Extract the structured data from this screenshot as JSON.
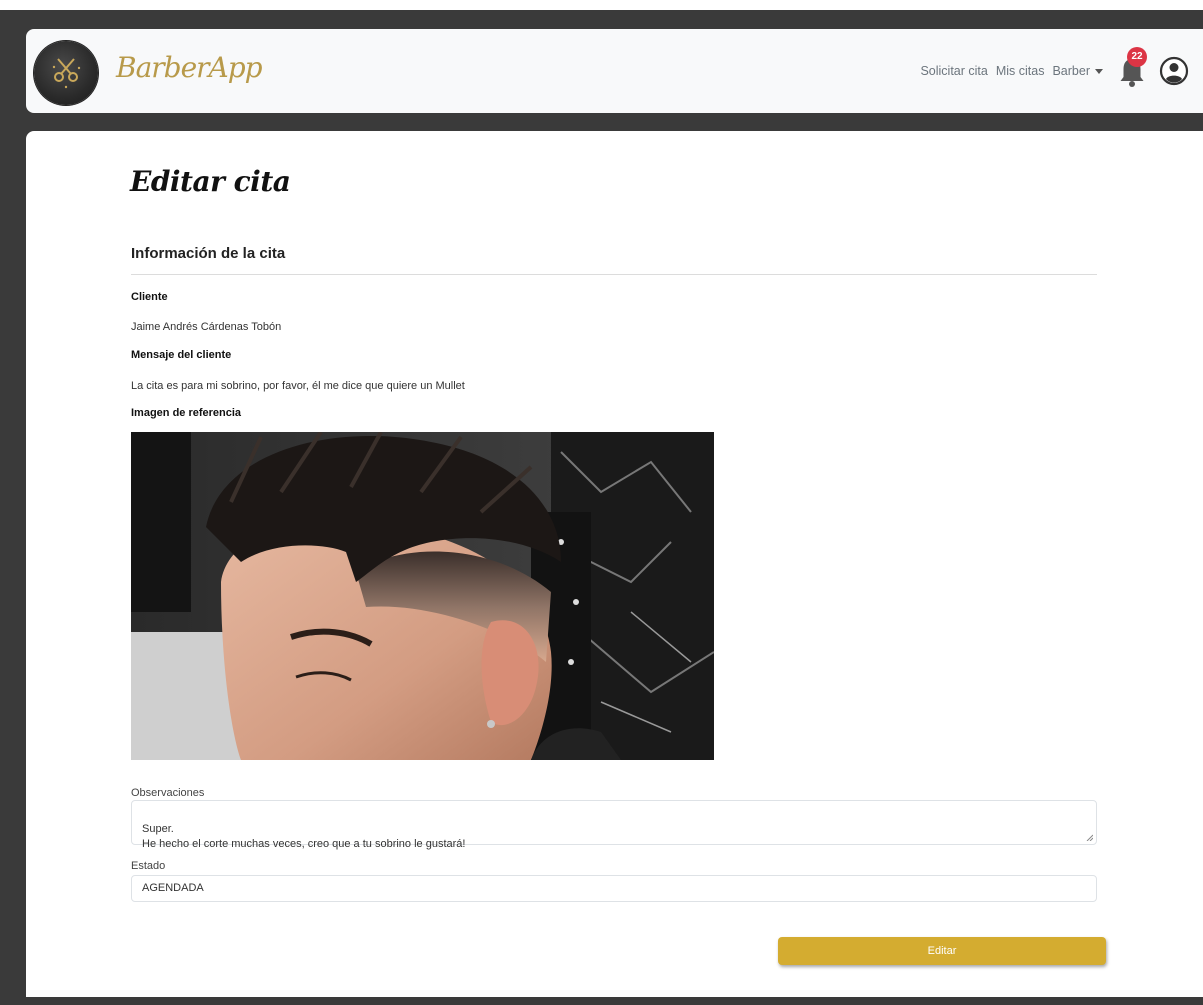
{
  "brand": {
    "name": "BarberApp"
  },
  "nav": {
    "request_appointment": "Solicitar cita",
    "my_appointments": "Mis citas",
    "role_menu": "Barber",
    "notification_count": "22"
  },
  "page": {
    "title": "Editar cita"
  },
  "section": {
    "title": "Información de la cita"
  },
  "client": {
    "label": "Cliente",
    "name": "Jaime Andrés Cárdenas Tobón"
  },
  "message": {
    "label": "Mensaje del cliente",
    "text": "La cita es para mi sobrino, por favor, él me dice que quiere un Mullet"
  },
  "reference_image": {
    "label": "Imagen de referencia"
  },
  "observations": {
    "label": "Observaciones",
    "value": "Super.\nHe hecho el corte muchas veces, creo que a tu sobrino le gustará!"
  },
  "status": {
    "label": "Estado",
    "value": "AGENDADA"
  },
  "actions": {
    "edit_label": "Editar"
  },
  "colors": {
    "accent": "#d4ac30",
    "badge": "#dc3545",
    "brand_text": "#b89a4a"
  }
}
